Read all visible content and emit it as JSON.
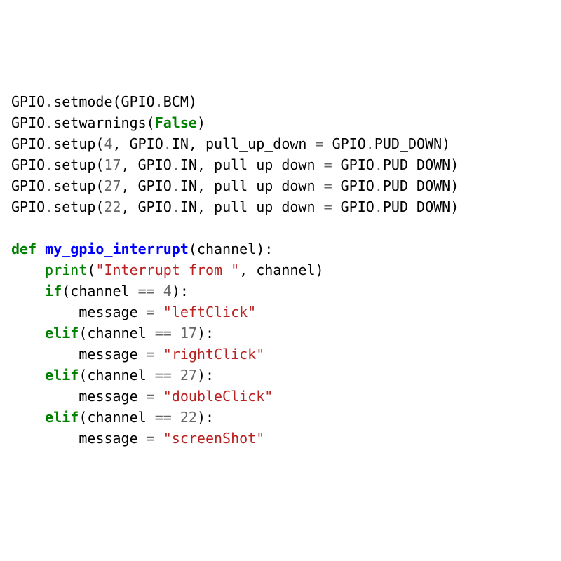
{
  "lines": {
    "l1": {
      "s1": "GPIO",
      "s2": ".",
      "s3": "setmode(GPIO",
      "s4": ".",
      "s5": "BCM)"
    },
    "l2": {
      "s1": "GPIO",
      "s2": ".",
      "s3": "setwarnings(",
      "s4": "False",
      "s5": ")"
    },
    "l3": {
      "s1": "GPIO",
      "s2": ".",
      "s3": "setup(",
      "s4": "4",
      "s5": ", GPIO",
      "s6": ".",
      "s7": "IN, pull_up_down ",
      "s8": "=",
      "s9": " GPIO",
      "s10": ".",
      "s11": "PUD_DOWN)"
    },
    "l4": {
      "s1": "GPIO",
      "s2": ".",
      "s3": "setup(",
      "s4": "17",
      "s5": ", GPIO",
      "s6": ".",
      "s7": "IN, pull_up_down ",
      "s8": "=",
      "s9": " GPIO",
      "s10": ".",
      "s11": "PUD_DOWN)"
    },
    "l5": {
      "s1": "GPIO",
      "s2": ".",
      "s3": "setup(",
      "s4": "27",
      "s5": ", GPIO",
      "s6": ".",
      "s7": "IN, pull_up_down ",
      "s8": "=",
      "s9": " GPIO",
      "s10": ".",
      "s11": "PUD_DOWN)"
    },
    "l6": {
      "s1": "GPIO",
      "s2": ".",
      "s3": "setup(",
      "s4": "22",
      "s5": ", GPIO",
      "s6": ".",
      "s7": "IN, pull_up_down ",
      "s8": "=",
      "s9": " GPIO",
      "s10": ".",
      "s11": "PUD_DOWN)"
    },
    "l8": {
      "s1": "def",
      "s2": " ",
      "s3": "my_gpio_interrupt",
      "s4": "(channel):"
    },
    "l9": {
      "s1": "    ",
      "s2": "print",
      "s3": "(",
      "s4": "\"Interrupt from \"",
      "s5": ", channel)"
    },
    "l10": {
      "s1": "    ",
      "s2": "if",
      "s3": "(channel ",
      "s4": "==",
      "s5": " ",
      "s6": "4",
      "s7": "):"
    },
    "l11": {
      "s1": "        message ",
      "s2": "=",
      "s3": " ",
      "s4": "\"leftClick\""
    },
    "l12": {
      "s1": "    ",
      "s2": "elif",
      "s3": "(channel ",
      "s4": "==",
      "s5": " ",
      "s6": "17",
      "s7": "):"
    },
    "l13": {
      "s1": "        message ",
      "s2": "=",
      "s3": " ",
      "s4": "\"rightClick\""
    },
    "l14": {
      "s1": "    ",
      "s2": "elif",
      "s3": "(channel ",
      "s4": "==",
      "s5": " ",
      "s6": "27",
      "s7": "):"
    },
    "l15": {
      "s1": "        message ",
      "s2": "=",
      "s3": " ",
      "s4": "\"doubleClick\""
    },
    "l16": {
      "s1": "    ",
      "s2": "elif",
      "s3": "(channel ",
      "s4": "==",
      "s5": " ",
      "s6": "22",
      "s7": "):"
    },
    "l17": {
      "s1": "        message ",
      "s2": "=",
      "s3": " ",
      "s4": "\"screenShot\""
    }
  }
}
